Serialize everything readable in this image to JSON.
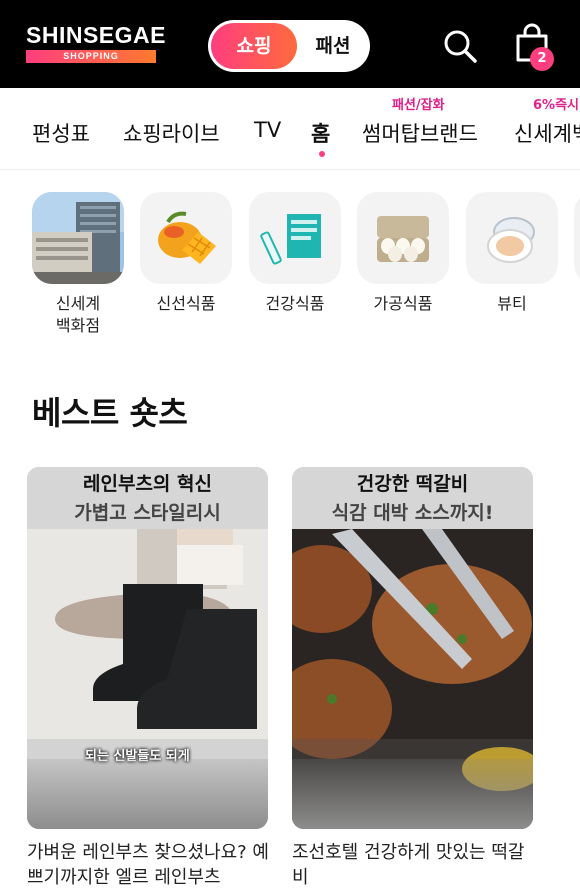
{
  "header": {
    "logo_main": "SHINSEGAE",
    "logo_sub": "SHOPPING",
    "toggle_active": "쇼핑",
    "toggle_other": "패션",
    "cart_count": "2"
  },
  "tabs": {
    "items": [
      {
        "label": "편성표"
      },
      {
        "label": "쇼핑라이브"
      },
      {
        "label": "TV"
      },
      {
        "label": "홈",
        "active": true
      },
      {
        "label": "썸머탑브랜드",
        "tag": "패션/잡화"
      },
      {
        "label": "신세계백",
        "tag": "6%즉시"
      }
    ]
  },
  "categories": [
    {
      "label": "신세계\n백화점",
      "icon": "department-store-photo"
    },
    {
      "label": "신선식품",
      "icon": "mango-icon"
    },
    {
      "label": "건강식품",
      "icon": "probiotics-box-icon"
    },
    {
      "label": "가공식품",
      "icon": "egg-carton-icon"
    },
    {
      "label": "뷰티",
      "icon": "cushion-compact-icon"
    }
  ],
  "section": {
    "title": "베스트 숏츠"
  },
  "shorts": [
    {
      "header_line1": "레인부츠의 혁신",
      "header_line2": "가볍고 스타일리시",
      "caption": "되는 신발들도 되게",
      "description": "가벼운 레인부츠 찾으셨나요? 예쁘기까지한 엘르 레인부츠"
    },
    {
      "header_line1": "건강한 떡갈비",
      "header_line2": "식감 대박 소스까지!",
      "caption": "",
      "description": "조선호텔 건강하게 맛있는 떡갈비"
    }
  ],
  "colors": {
    "accent": "#ff3e7f",
    "accent2": "#ff6a3d",
    "tag": "#e0208c",
    "header_bg": "#000000"
  }
}
